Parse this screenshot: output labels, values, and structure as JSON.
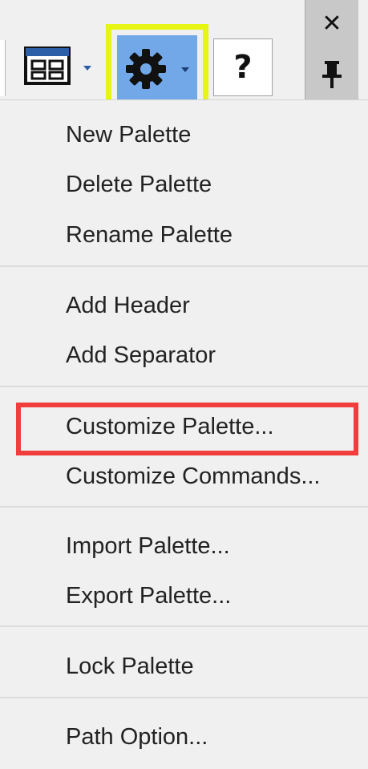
{
  "toolbar": {
    "view_button_icon": "palette-view-icon",
    "settings_button_icon": "gear-icon",
    "help_label": "?",
    "close_label": "✕",
    "pin_icon": "pin-icon",
    "highlight_color": "#e6f516",
    "active_color": "#72a8e8"
  },
  "menu": {
    "items": [
      {
        "label": "New Palette"
      },
      {
        "label": "Delete Palette"
      },
      {
        "label": "Rename Palette"
      },
      {
        "label": "Add Header"
      },
      {
        "label": "Add Separator"
      },
      {
        "label": "Customize Palette..."
      },
      {
        "label": "Customize Commands..."
      },
      {
        "label": "Import Palette..."
      },
      {
        "label": "Export Palette..."
      },
      {
        "label": "Lock Palette"
      },
      {
        "label": "Path Option..."
      }
    ],
    "highlight_color": "#f23d3d"
  }
}
